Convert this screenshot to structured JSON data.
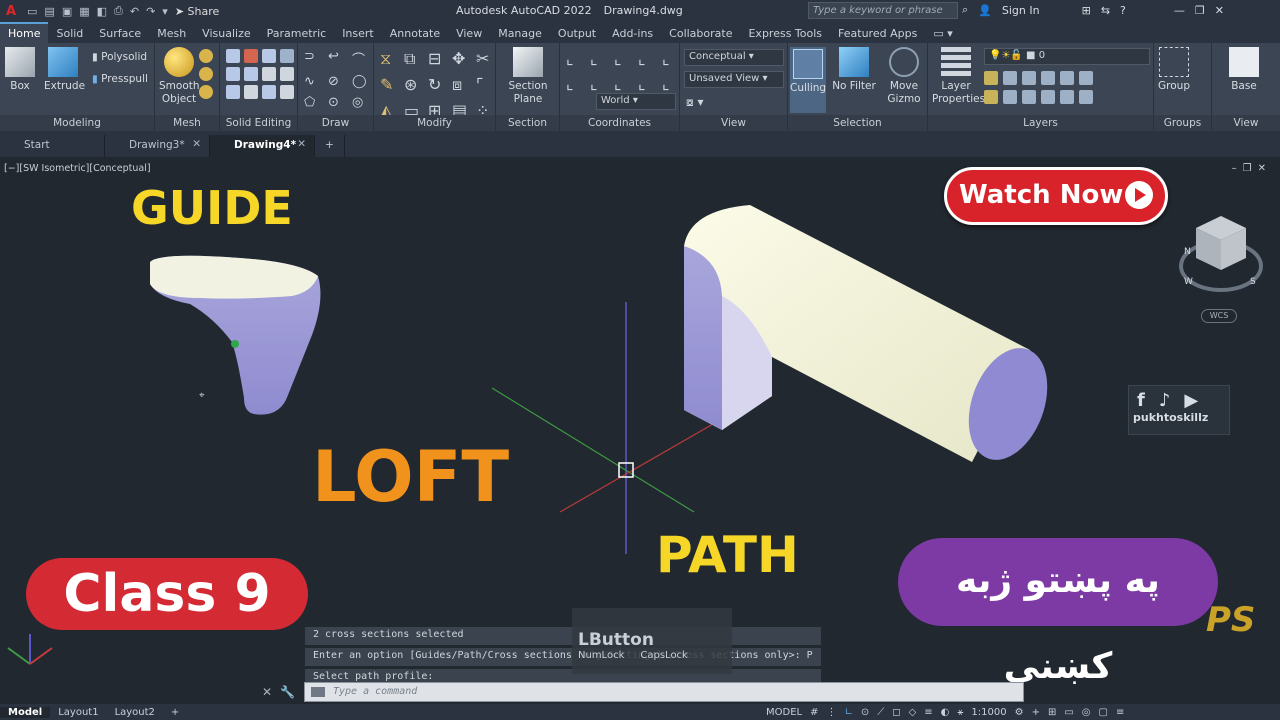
{
  "app": {
    "title": "Autodesk AutoCAD 2022",
    "file": "Drawing4.dwg",
    "share": "Share",
    "search_placeholder": "Type a keyword or phrase",
    "sign_in": "Sign In"
  },
  "ribbon_tabs": [
    "Home",
    "Solid",
    "Surface",
    "Mesh",
    "Visualize",
    "Parametric",
    "Insert",
    "Annotate",
    "View",
    "Manage",
    "Output",
    "Add-ins",
    "Collaborate",
    "Express Tools",
    "Featured Apps"
  ],
  "ribbon": {
    "box": "Box",
    "extrude": "Extrude",
    "polysolid": "Polysolid",
    "presspull": "Presspull",
    "smooth_object": "Smooth Object",
    "section_plane": "Section Plane",
    "culling": "Culling",
    "no_filter": "No Filter",
    "move_gizmo": "Move Gizmo",
    "layer_properties": "Layer Properties",
    "group": "Group",
    "base": "Base",
    "visual_style": "Conceptual",
    "view_state": "Unsaved View",
    "ucs": "World",
    "layer_name": "0",
    "panel_titles": [
      "Modeling",
      "Mesh",
      "Solid Editing",
      "Draw",
      "Modify",
      "Section",
      "Coordinates",
      "View",
      "Selection",
      "Layers",
      "Groups",
      "View"
    ]
  },
  "doc_tabs": [
    {
      "label": "Start"
    },
    {
      "label": "Drawing3*"
    },
    {
      "label": "Drawing4*"
    }
  ],
  "viewport": {
    "label": "[−][SW Isometric][Conceptual]",
    "wcs": "WCS"
  },
  "overlays": {
    "guide": "GUIDE",
    "loft": "LOFT",
    "path": "PATH",
    "watch_now": "Watch Now",
    "class": "Class 9",
    "pashto": "په پښتو ژبه کښني",
    "social_handle": "pukhtoskillz",
    "brand": "PS"
  },
  "command": {
    "history": [
      "2 cross sections selected",
      "Enter an option [Guides/Path/Cross sections only/Settings] <Cross sections only>: P",
      "Select path profile:"
    ],
    "placeholder": "Type a command",
    "tooltip_big": "LButton",
    "tooltip_a": "NumLock",
    "tooltip_b": "CapsLock"
  },
  "status": {
    "layouts": [
      "Model",
      "Layout1",
      "Layout2"
    ],
    "space": "MODEL",
    "scale": "1:1000"
  },
  "colors": {
    "accent_red": "#d8232a",
    "guide_yellow": "#f6d626",
    "loft_orange": "#f0921b",
    "pashto_purple": "#7d3aa5"
  }
}
